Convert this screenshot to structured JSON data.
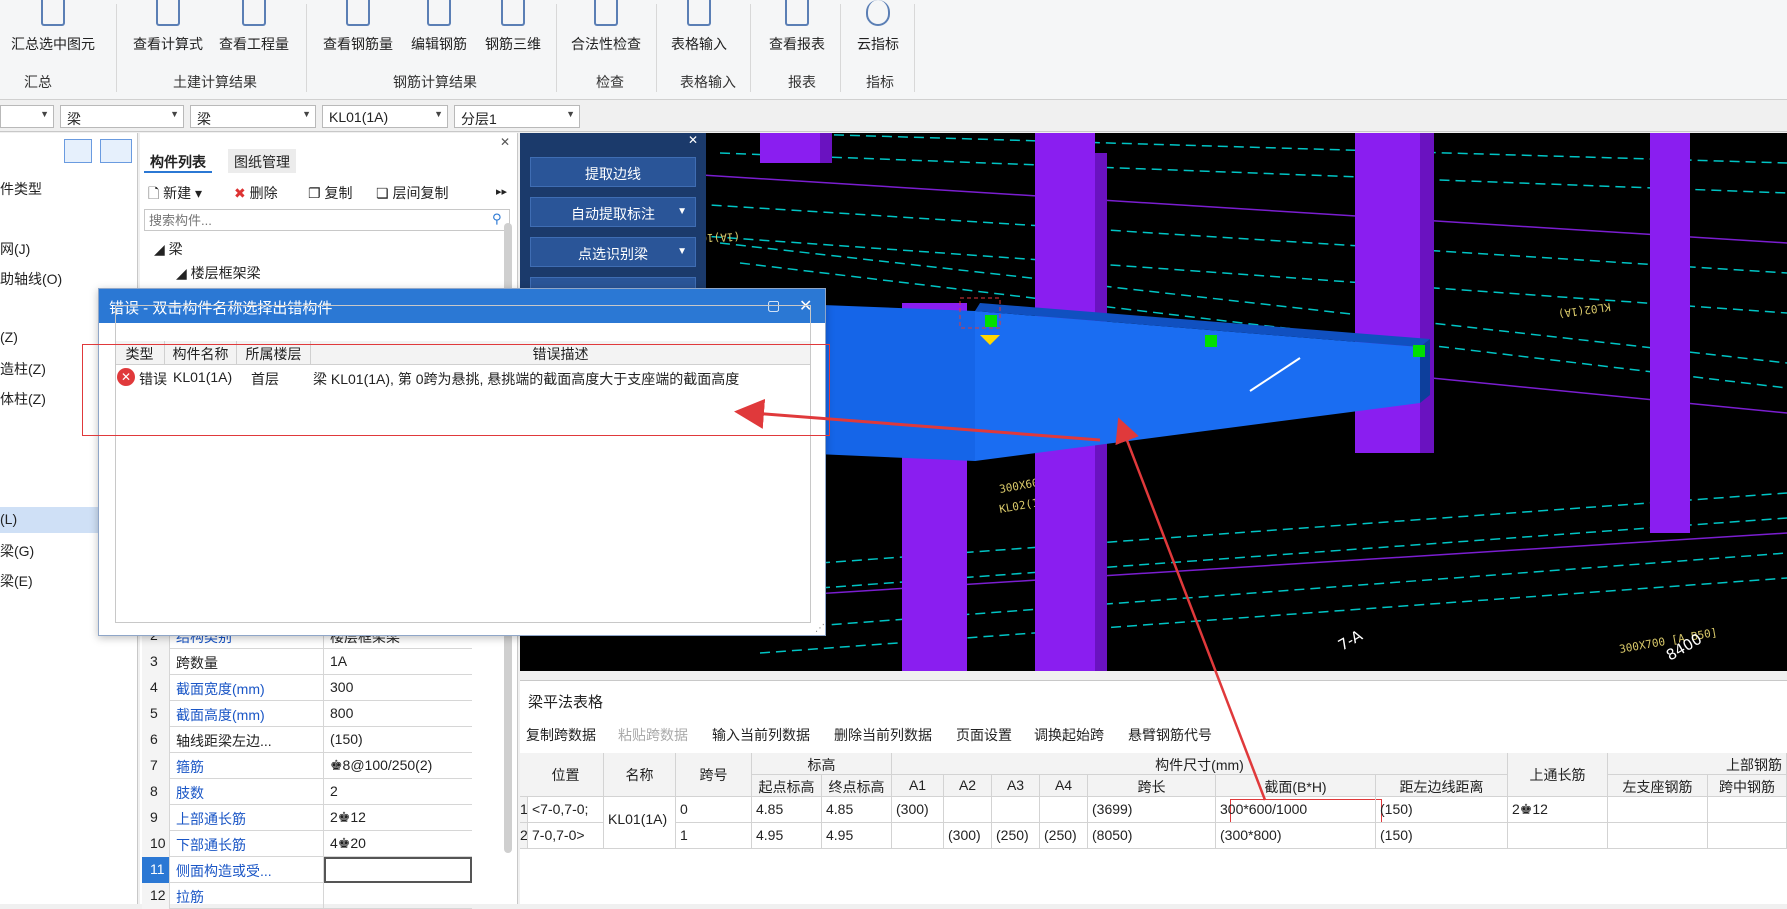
{
  "ribbon": {
    "buttons": [
      {
        "label": "汇总选中图元",
        "icon": "summary-icon"
      },
      {
        "label": "查看计算式",
        "icon": "formula-icon"
      },
      {
        "label": "查看工程量",
        "icon": "quantity-icon"
      },
      {
        "label": "查看钢筋量",
        "icon": "rebar-quantity-icon"
      },
      {
        "label": "编辑钢筋",
        "icon": "edit-rebar-icon"
      },
      {
        "label": "钢筋三维",
        "icon": "rebar-3d-icon"
      },
      {
        "label": "合法性检查",
        "icon": "check-icon"
      },
      {
        "label": "表格输入",
        "icon": "table-input-icon"
      },
      {
        "label": "查看报表",
        "icon": "report-icon"
      },
      {
        "label": "云指标",
        "icon": "cloud-icon"
      }
    ],
    "groups": [
      "汇总",
      "土建计算结果",
      "钢筋计算结果",
      "检查",
      "表格输入",
      "报表",
      "指标"
    ]
  },
  "selectors": {
    "s0": "",
    "s1": "梁",
    "s2": "梁",
    "s3": "KL01(1A)",
    "s4": "分层1"
  },
  "leftnav": {
    "items": [
      "件类型",
      "网(J)",
      "助轴线(O)",
      "(Z)",
      "造柱(Z)",
      "体柱(Z)",
      "(L)",
      "梁(G)",
      "梁(E)"
    ]
  },
  "complist": {
    "tabs": [
      "构件列表",
      "图纸管理"
    ],
    "toolbar": {
      "new": "新建",
      "delete": "删除",
      "copy": "复制",
      "floor_copy": "层间复制"
    },
    "search_placeholder": "搜索构件...",
    "tree_root": "梁",
    "tree_child": "楼层框架梁"
  },
  "properties": [
    {
      "n": "2",
      "k": "结构类别",
      "v": "楼层框架梁",
      "blue": true
    },
    {
      "n": "3",
      "k": "跨数量",
      "v": "1A",
      "blue": false
    },
    {
      "n": "4",
      "k": "截面宽度(mm)",
      "v": "300",
      "blue": true
    },
    {
      "n": "5",
      "k": "截面高度(mm)",
      "v": "800",
      "blue": true
    },
    {
      "n": "6",
      "k": "轴线距梁左边...",
      "v": "(150)",
      "blue": false
    },
    {
      "n": "7",
      "k": "箍筋",
      "v": "♚8@100/250(2)",
      "blue": true
    },
    {
      "n": "8",
      "k": "肢数",
      "v": "2",
      "blue": true
    },
    {
      "n": "9",
      "k": "上部通长筋",
      "v": "2♚12",
      "blue": true
    },
    {
      "n": "10",
      "k": "下部通长筋",
      "v": "4♚20",
      "blue": true
    },
    {
      "n": "11",
      "k": "侧面构造或受...",
      "v": "",
      "blue": true
    },
    {
      "n": "12",
      "k": "拉筋",
      "v": "",
      "blue": true
    }
  ],
  "toolpanel": {
    "extract_edge": "提取边线",
    "auto_extract_label": "自动提取标注",
    "point_identify_beam": "点选识别梁"
  },
  "dialog": {
    "title": "错误 - 双击构件名称选择出错构件",
    "columns": [
      "类型",
      "构件名称",
      "所属楼层",
      "错误描述"
    ],
    "rows": [
      {
        "type": "错误",
        "name": "KL01(1A)",
        "floor": "首层",
        "desc": "梁 KL01(1A), 第 0跨为悬挑, 悬挑端的截面高度大于支座端的截面高度"
      }
    ]
  },
  "view3d": {
    "labels": [
      "7-A",
      "8400"
    ]
  },
  "bottom": {
    "title": "梁平法表格",
    "toolbar": [
      "复制跨数据",
      "粘贴跨数据",
      "输入当前列数据",
      "删除当前列数据",
      "页面设置",
      "调换起始跨",
      "悬臂钢筋代号"
    ],
    "headers": {
      "position": "位置",
      "name": "名称",
      "span_no": "跨号",
      "elevation": "标高",
      "start_elev": "起点标高",
      "end_elev": "终点标高",
      "dims": "构件尺寸(mm)",
      "a1": "A1",
      "a2": "A2",
      "a3": "A3",
      "a4": "A4",
      "span_len": "跨长",
      "section": "截面(B*H)",
      "dist_left": "距左边线距离",
      "top_cont": "上通长筋",
      "top_rebar": "上部钢筋",
      "left_support": "左支座钢筋",
      "mid_span": "跨中钢筋"
    },
    "rows": [
      {
        "idx": "1",
        "position": "<7-0,7-0;",
        "span": "0",
        "start": "4.85",
        "end": "4.85",
        "a1": "(300)",
        "a2": "",
        "a3": "",
        "a4": "",
        "len": "(3699)",
        "section": "300*600/1000",
        "dist": "(150)",
        "top": "2♚12"
      },
      {
        "idx": "2",
        "position": "7-0,7-0>",
        "span": "1",
        "start": "4.95",
        "end": "4.95",
        "a1": "",
        "a2": "(300)",
        "a3": "(250)",
        "a4": "(250)",
        "len": "(8050)",
        "section": "(300*800)",
        "dist": "(150)",
        "top": ""
      }
    ],
    "merged_name": "KL01(1A)"
  },
  "colors": {
    "accent": "#2b78d4",
    "beam": "#1565e8",
    "column": "#8a1ef0",
    "error": "#e0393b",
    "marker": "#00e000"
  }
}
